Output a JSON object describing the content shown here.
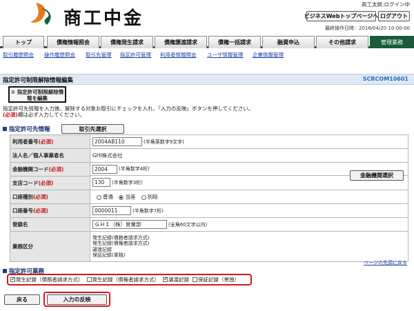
{
  "header": {
    "logo_text": "商工中金",
    "user_status": "商工太郎:ログイン中",
    "home_button": "ビジネスWebトップページへ",
    "logout_button": "ログアウト",
    "last_operation": "最終操作日時：2016/04/20 10:00:00"
  },
  "tabs": [
    "トップ",
    "債権情報照会",
    "債権発生請求",
    "債権譲渡請求",
    "債権一括請求",
    "融資申込",
    "その他請求",
    "管理業務"
  ],
  "subnav": [
    "取引履歴照会",
    "操作履歴照会",
    "取引先管理",
    "指定許可管理",
    "利用者情報照会",
    "ユーザ情報管理",
    "企業情報管理"
  ],
  "page": {
    "title": "指定許可制限解除情報編集",
    "code": "SCRCOM10601",
    "step_button": "① 指定許可制限解除情報を編集",
    "instruction": "指定許可先情報を入力後、解除する対象お取引にチェックを入れ、「入力の反映」ボタンを押してください。",
    "required_prefix": "(必須)",
    "required_suffix": "欄は必ず入力してください。"
  },
  "section1": {
    "title": "指定許可先情報",
    "select_button": "取引先選択"
  },
  "form": {
    "user_no_label": "利用者番号",
    "user_no_value": "2004AB110",
    "user_no_hint": "(半角英数字9文字)",
    "corp_name_label": "法人名／個人事業者名",
    "corp_name_value": "GHI株式会社",
    "bank_code_label": "金融機関コード",
    "bank_code_value": "2004",
    "bank_code_hint": "(半角数字4桁)",
    "bank_select_button": "金融機関選択",
    "branch_code_label": "支店コード",
    "branch_code_value": "130",
    "branch_code_hint": "(半角数字3桁)",
    "account_type_label": "口座種別",
    "account_types": [
      "普通",
      "当座",
      "別段"
    ],
    "account_no_label": "口座番号",
    "account_no_value": "0000011",
    "account_no_hint": "(半角数字7桁)",
    "reg_name_label": "登録名",
    "reg_name_value": "ＧＨＩ（株）営業部",
    "reg_name_hint": "(全角60文字以内)",
    "business_label": "業務区分",
    "business_values": [
      "発生記録(債務者請求方式)",
      "発生記録(債権者請求方式)",
      "譲渡記録",
      "保証記録(単独)"
    ],
    "required_mark": "(必須)"
  },
  "section2": {
    "title": "指定許可業務",
    "page_top": "ページの先頭に戻る",
    "checkboxes": [
      {
        "label": "発生記録（債務者請求方式）",
        "checked": true
      },
      {
        "label": "発生記録（債権者請求方式）",
        "checked": false
      },
      {
        "label": "譲渡記録",
        "checked": true
      },
      {
        "label": "保証記録（単独）",
        "checked": false
      }
    ]
  },
  "footer": {
    "back_button": "戻る",
    "apply_button": "入力の反映"
  },
  "colors": {
    "brand_green": "#1a5c3a",
    "highlight_red": "#d9141c",
    "link_blue": "#1d3fa8",
    "logo_orange": "#e87a1e"
  }
}
